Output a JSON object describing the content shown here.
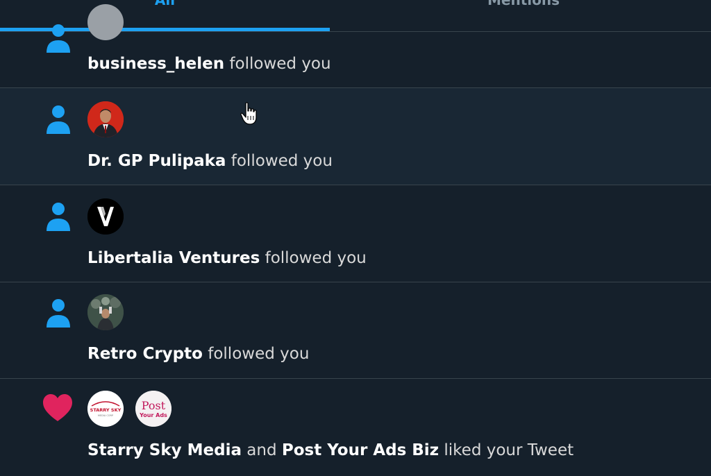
{
  "tabs": {
    "all": "All",
    "mentions": "Mentions"
  },
  "colors": {
    "background": "#15202b",
    "hover_background": "#192734",
    "accent": "#1da1f2",
    "like": "#e0245e",
    "divider": "#38444d"
  },
  "notifications": [
    {
      "type": "follow",
      "icon": "person-icon",
      "actors": [
        "business_helen"
      ],
      "action": " followed you"
    },
    {
      "type": "follow",
      "icon": "person-icon",
      "actors": [
        "Dr. GP Pulipaka"
      ],
      "action": " followed you"
    },
    {
      "type": "follow",
      "icon": "person-icon",
      "actors": [
        "Libertalia Ventures"
      ],
      "action": " followed you"
    },
    {
      "type": "follow",
      "icon": "person-icon",
      "actors": [
        "Retro Crypto"
      ],
      "action": " followed you"
    },
    {
      "type": "like",
      "icon": "heart-icon",
      "actors": [
        "Starry Sky Media",
        "Post Your Ads Biz"
      ],
      "connector": " and ",
      "action": " liked your Tweet",
      "avatar_text": {
        "starry": "STARRY SKY",
        "starry_sub": "MEDIA CORP",
        "post_line1": "Post",
        "post_line2": "Your Ads"
      }
    }
  ]
}
